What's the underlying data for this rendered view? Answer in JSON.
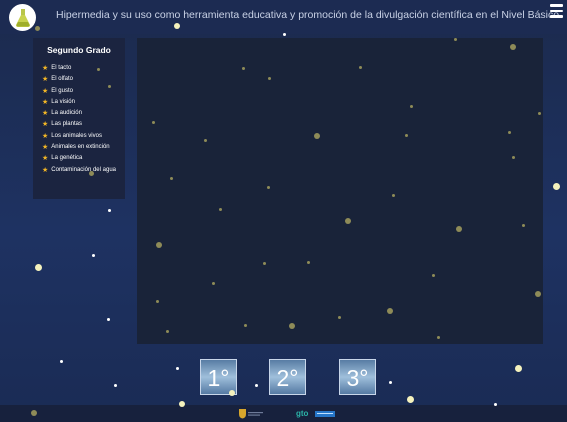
{
  "header": {
    "title": "Hipermedia y su uso como herramienta educativa y promoción de la divulgación científica en el Nivel Básico",
    "logo_icon": "flask-icon",
    "menu_icon": "hamburger-menu-icon"
  },
  "sidebar": {
    "title": "Segundo Grado",
    "items": [
      {
        "label": "El tacto"
      },
      {
        "label": "El olfato"
      },
      {
        "label": "El gusto"
      },
      {
        "label": "La visión"
      },
      {
        "label": "La audición"
      },
      {
        "label": "Las plantas"
      },
      {
        "label": "Los animales vivos"
      },
      {
        "label": "Animales en extinción"
      },
      {
        "label": "La genética"
      },
      {
        "label": "Contaminación del agua"
      }
    ]
  },
  "grades": {
    "first": "1°",
    "second": "2°",
    "third": "3°"
  },
  "colors": {
    "background": "#1e3262",
    "panel": "#192339",
    "star": "#f2b625",
    "accent": "#f5f2bd"
  }
}
